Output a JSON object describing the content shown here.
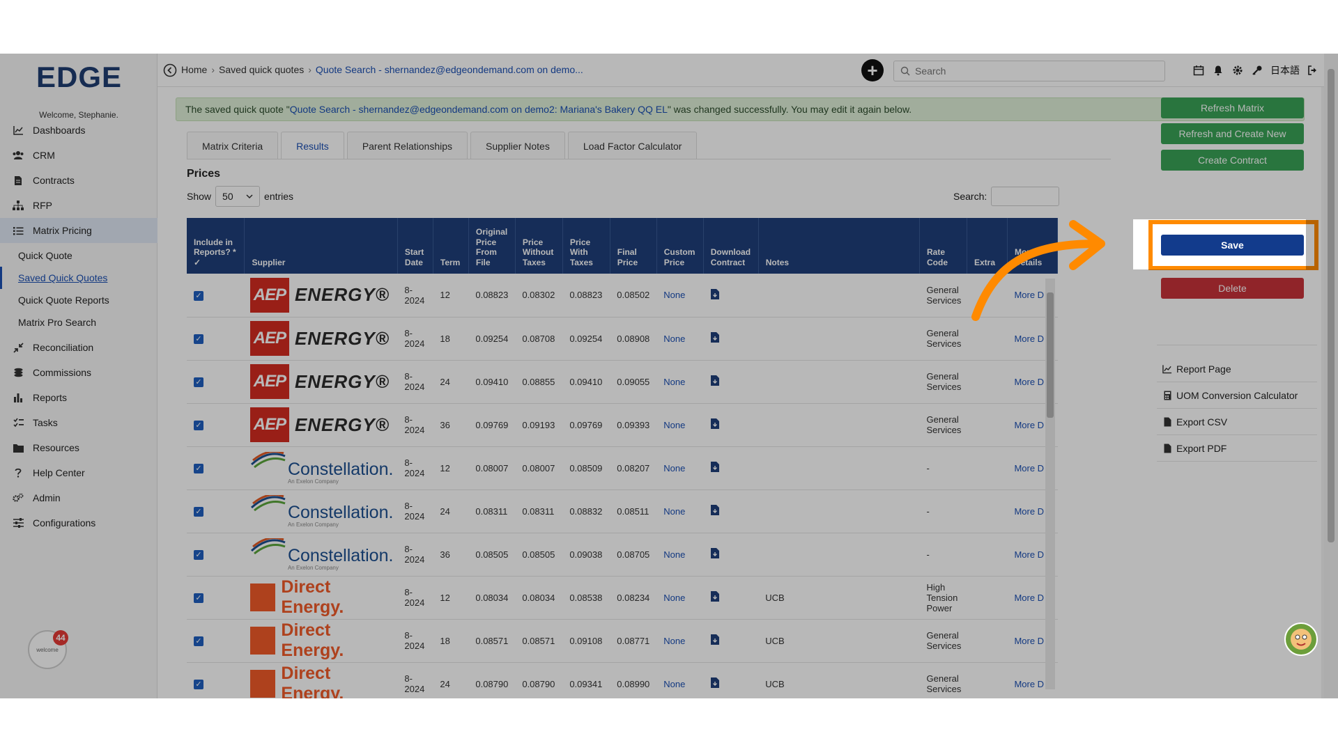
{
  "brand": {
    "logo_text": "EDGE",
    "welcome": "Welcome, Stephanie."
  },
  "sidebar": {
    "items": [
      {
        "label": "Dashboards",
        "icon": "chart-line-icon"
      },
      {
        "label": "CRM",
        "icon": "users-icon"
      },
      {
        "label": "Contracts",
        "icon": "file-icon"
      },
      {
        "label": "RFP",
        "icon": "sitemap-icon"
      },
      {
        "label": "Matrix Pricing",
        "icon": "list-icon"
      }
    ],
    "sub_items": [
      {
        "label": "Quick Quote"
      },
      {
        "label": "Saved Quick Quotes"
      },
      {
        "label": "Quick Quote Reports"
      },
      {
        "label": "Matrix Pro Search"
      }
    ],
    "items_after": [
      {
        "label": "Reconciliation",
        "icon": "compress-icon"
      },
      {
        "label": "Commissions",
        "icon": "coins-icon"
      },
      {
        "label": "Reports",
        "icon": "bar-chart-icon"
      },
      {
        "label": "Tasks",
        "icon": "tasks-icon"
      },
      {
        "label": "Resources",
        "icon": "folder-icon"
      },
      {
        "label": "Help Center",
        "icon": "question-icon"
      },
      {
        "label": "Admin",
        "icon": "cogs-icon"
      },
      {
        "label": "Configurations",
        "icon": "sliders-icon"
      }
    ],
    "notification_count": "44",
    "badge_text": "welcome"
  },
  "topbar": {
    "breadcrumb": {
      "home": "Home",
      "saved": "Saved quick quotes",
      "current": "Quote Search - shernandez@edgeondemand.com on demo..."
    },
    "search_placeholder": "Search",
    "language": "日本語"
  },
  "alert": {
    "prefix": "The saved quick quote \"",
    "quote_name": "Quote Search - shernandez@edgeondemand.com on demo2: Mariana's Bakery QQ EL",
    "suffix": "\" was changed successfully. You may edit it again below.",
    "close": "×"
  },
  "tabs": [
    {
      "label": "Matrix Criteria"
    },
    {
      "label": "Results"
    },
    {
      "label": "Parent Relationships"
    },
    {
      "label": "Supplier Notes"
    },
    {
      "label": "Load Factor Calculator"
    }
  ],
  "prices": {
    "title": "Prices",
    "show_label": "Show",
    "entries_value": "50",
    "entries_label": "entries",
    "search_label": "Search:"
  },
  "table": {
    "headers": [
      "Include in Reports? * ✓",
      "Supplier",
      "Start Date",
      "Term",
      "Original Price From File",
      "Price Without Taxes",
      "Price With Taxes",
      "Final Price",
      "Custom Price",
      "Download Contract",
      "Notes",
      "Rate Code",
      "Extra",
      "More Details"
    ],
    "rows": [
      {
        "supplier": "aep",
        "start": "8-2024",
        "term": "12",
        "orig": "0.08823",
        "without": "0.08302",
        "with": "0.08823",
        "final": "0.08502",
        "custom": "None",
        "notes": "",
        "rate": "General Services",
        "extra": "",
        "more": "More D"
      },
      {
        "supplier": "aep",
        "start": "8-2024",
        "term": "18",
        "orig": "0.09254",
        "without": "0.08708",
        "with": "0.09254",
        "final": "0.08908",
        "custom": "None",
        "notes": "",
        "rate": "General Services",
        "extra": "",
        "more": "More D"
      },
      {
        "supplier": "aep",
        "start": "8-2024",
        "term": "24",
        "orig": "0.09410",
        "without": "0.08855",
        "with": "0.09410",
        "final": "0.09055",
        "custom": "None",
        "notes": "",
        "rate": "General Services",
        "extra": "",
        "more": "More D"
      },
      {
        "supplier": "aep",
        "start": "8-2024",
        "term": "36",
        "orig": "0.09769",
        "without": "0.09193",
        "with": "0.09769",
        "final": "0.09393",
        "custom": "None",
        "notes": "",
        "rate": "General Services",
        "extra": "",
        "more": "More D"
      },
      {
        "supplier": "constellation",
        "start": "8-2024",
        "term": "12",
        "orig": "0.08007",
        "without": "0.08007",
        "with": "0.08509",
        "final": "0.08207",
        "custom": "None",
        "notes": "",
        "rate": "-",
        "extra": "",
        "more": "More D"
      },
      {
        "supplier": "constellation",
        "start": "8-2024",
        "term": "24",
        "orig": "0.08311",
        "without": "0.08311",
        "with": "0.08832",
        "final": "0.08511",
        "custom": "None",
        "notes": "",
        "rate": "-",
        "extra": "",
        "more": "More D"
      },
      {
        "supplier": "constellation",
        "start": "8-2024",
        "term": "36",
        "orig": "0.08505",
        "without": "0.08505",
        "with": "0.09038",
        "final": "0.08705",
        "custom": "None",
        "notes": "",
        "rate": "-",
        "extra": "",
        "more": "More D"
      },
      {
        "supplier": "direct",
        "start": "8-2024",
        "term": "12",
        "orig": "0.08034",
        "without": "0.08034",
        "with": "0.08538",
        "final": "0.08234",
        "custom": "None",
        "notes": "UCB",
        "rate": "High Tension Power",
        "extra": "",
        "more": "More D"
      },
      {
        "supplier": "direct",
        "start": "8-2024",
        "term": "18",
        "orig": "0.08571",
        "without": "0.08571",
        "with": "0.09108",
        "final": "0.08771",
        "custom": "None",
        "notes": "UCB",
        "rate": "General Services",
        "extra": "",
        "more": "More D"
      },
      {
        "supplier": "direct",
        "start": "8-2024",
        "term": "24",
        "orig": "0.08790",
        "without": "0.08790",
        "with": "0.09341",
        "final": "0.08990",
        "custom": "None",
        "notes": "UCB",
        "rate": "General Services",
        "extra": "",
        "more": "More D"
      }
    ]
  },
  "supplier_logos": {
    "aep": {
      "box": "AEP",
      "text": "ENERGY®"
    },
    "constellation": {
      "text": "Constellation.",
      "sub": "An Exelon Company"
    },
    "direct": {
      "text": "Direct Energy."
    }
  },
  "right_panel": {
    "refresh_matrix": "Refresh Matrix",
    "refresh_create": "Refresh and Create New",
    "create_contract": "Create Contract",
    "save": "Save",
    "delete": "Delete",
    "links": [
      {
        "label": "Report Page",
        "icon": "chart-line-icon"
      },
      {
        "label": "UOM Conversion Calculator",
        "icon": "calculator-icon"
      },
      {
        "label": "Export CSV",
        "icon": "file-csv-icon"
      },
      {
        "label": "Export PDF",
        "icon": "file-pdf-icon"
      }
    ]
  },
  "colors": {
    "header_blue": "#1f3f7a",
    "save_blue": "#123b8c",
    "green": "#3aa357",
    "red": "#c8333a",
    "highlight_orange": "#ff8a00",
    "link_blue": "#1b4fb3"
  }
}
